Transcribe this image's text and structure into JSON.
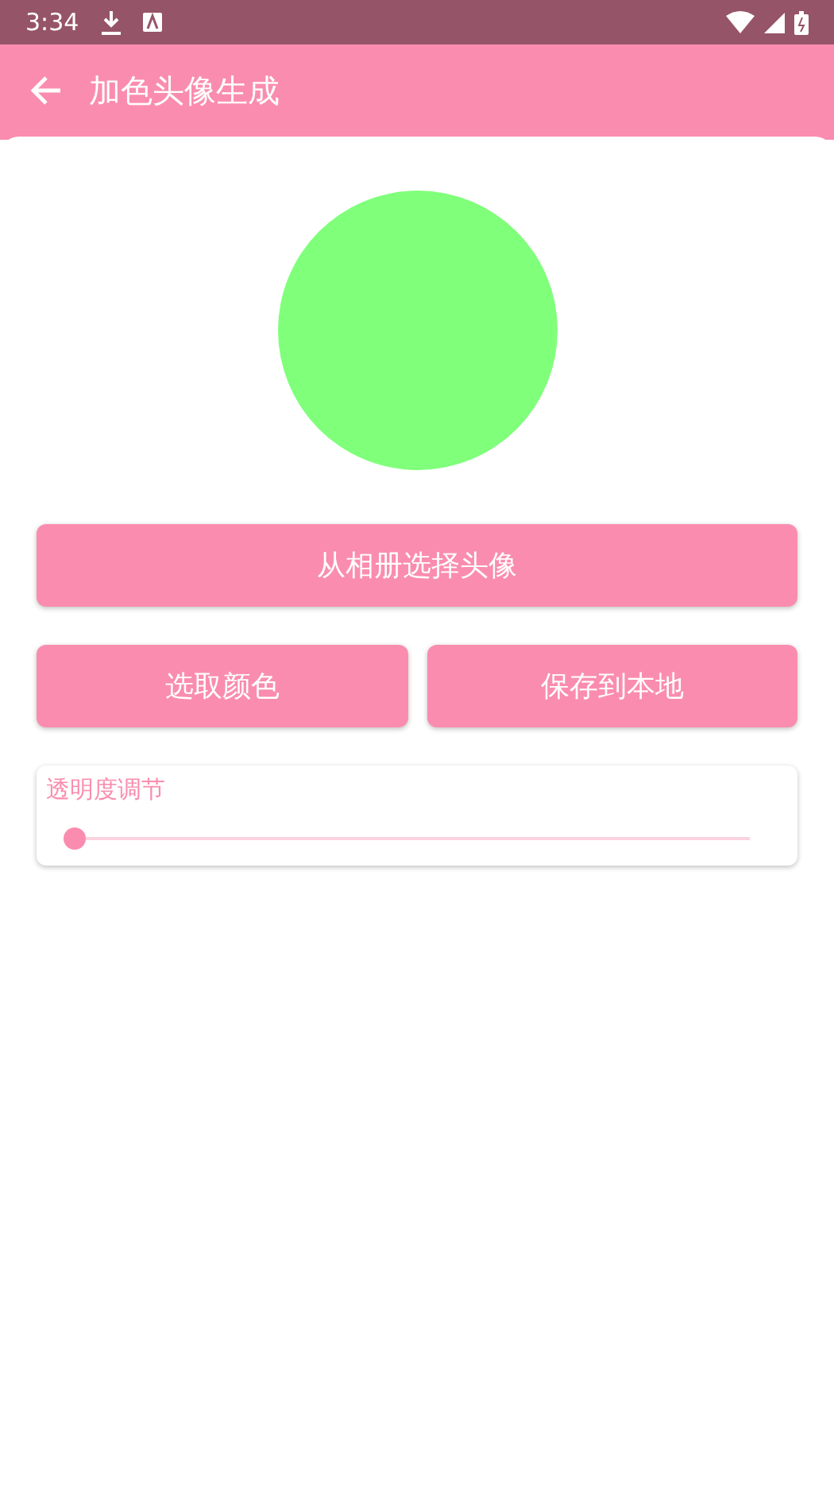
{
  "status_bar": {
    "time": "3:34"
  },
  "app_bar": {
    "title": "加色头像生成"
  },
  "preview": {
    "color": "#80ff7b"
  },
  "buttons": [
    {
      "label": "从相册选择头像",
      "kind": "wide"
    },
    {
      "label": "选取颜色",
      "kind": "half"
    },
    {
      "label": "保存到本地",
      "kind": "half"
    }
  ],
  "opacity": {
    "label": "透明度调节",
    "level": 0
  }
}
